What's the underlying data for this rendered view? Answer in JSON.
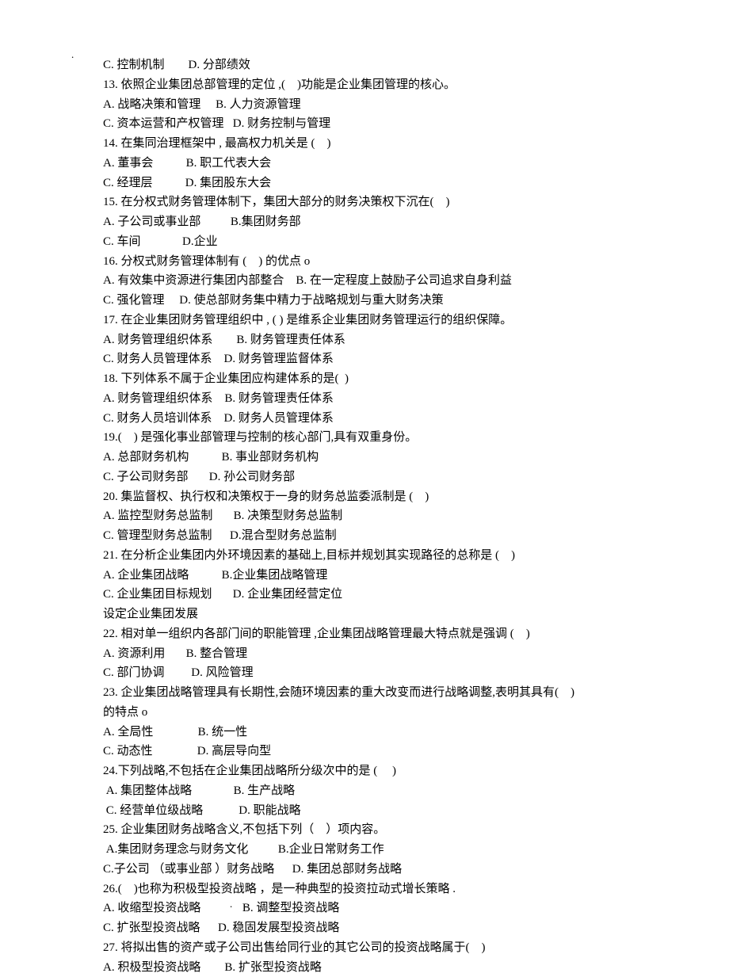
{
  "dot_top": ".",
  "dot_bottom": ". . .",
  "lines": [
    "C. 控制机制        D. 分部绩效",
    "13. 依照企业集团总部管理的定位 ,(    )功能是企业集团管理的核心。",
    "A. 战略决策和管理     B. 人力资源管理",
    "C. 资本运营和产权管理   D. 财务控制与管理",
    "14. 在集同治理框架中 , 最高权力机关是 (    )",
    "A. 董事会           B. 职工代表大会",
    "C. 经理层           D. 集团股东大会",
    "15. 在分权式财务管理体制下，集团大部分的财务决策权下沉在(    )",
    "A. 子公司或事业部          B.集团财务部",
    "C. 车间              D.企业",
    "16. 分权式财务管理体制有 (    ) 的优点 o",
    "A. 有效集中资源进行集团内部整合    B. 在一定程度上鼓励子公司追求自身利益",
    "C. 强化管理     D. 使总部财务集中精力于战略规划与重大财务决策",
    "17. 在企业集团财务管理组织中 , ( ) 是维系企业集团财务管理运行的组织保障。",
    "A. 财务管理组织体系        B. 财务管理责任体系",
    "C. 财务人员管理体系    D. 财务管理监督体系",
    "18. 下列体系不属于企业集团应构建体系的是(  )",
    "A. 财务管理组织体系    B. 财务管理责任体系",
    "C. 财务人员培训体系    D. 财务人员管理体系",
    "19.(    ) 是强化事业部管理与控制的核心部门,具有双重身份。",
    "A. 总部财务机构           B. 事业部财务机构",
    "C. 子公司财务部       D. 孙公司财务部",
    "20. 集监督权、执行权和决策权于一身的财务总监委派制是 (    )",
    "A. 监控型财务总监制       B. 决策型财务总监制",
    "C. 管理型财务总监制      D.混合型财务总监制",
    "21. 在分析企业集团内外环境因素的基础上,目标并规划其实现路径的总称是 (    )",
    "A. 企业集团战略           B.企业集团战略管理",
    "C. 企业集团目标规划       D. 企业集团经营定位",
    "设定企业集团发展",
    "22. 相对单一组织内各部门间的职能管理 ,企业集团战略管理最大特点就是强调 (    )",
    "A. 资源利用       B. 整合管理",
    "C. 部门协调         D. 风险管理",
    "23. 企业集团战略管理具有长期性,会随环境因素的重大改变而进行战略调整,表明其具有(    )",
    "的特点 o",
    "A. 全局性               B. 统一性",
    "C. 动态性               D. 高层导向型",
    "24.下列战略,不包括在企业集团战略所分级次中的是 (     )",
    " A. 集团整体战略              B. 生产战略",
    " C. 经营单位级战略            D. 职能战略",
    "25. 企业集团财务战略含义,不包括下列（    ）项内容。",
    " A.集团财务理念与财务文化          B.企业日常财务工作",
    "C.子公司 （或事业部 ）财务战略      D. 集团总部财务战略",
    "26.(    )也称为积极型投资战略 ，是一种典型的投资拉动式增长策略 .",
    "A. 收缩型投资战略              B. 调整型投资战略",
    "C. 扩张型投资战略      D. 稳固发展型投资战略",
    "27. 将拟出售的资产或子公司出售给同行业的其它公司的投资战略属于(    )",
    "A. 积极型投资战略        B. 扩张型投资战略"
  ]
}
